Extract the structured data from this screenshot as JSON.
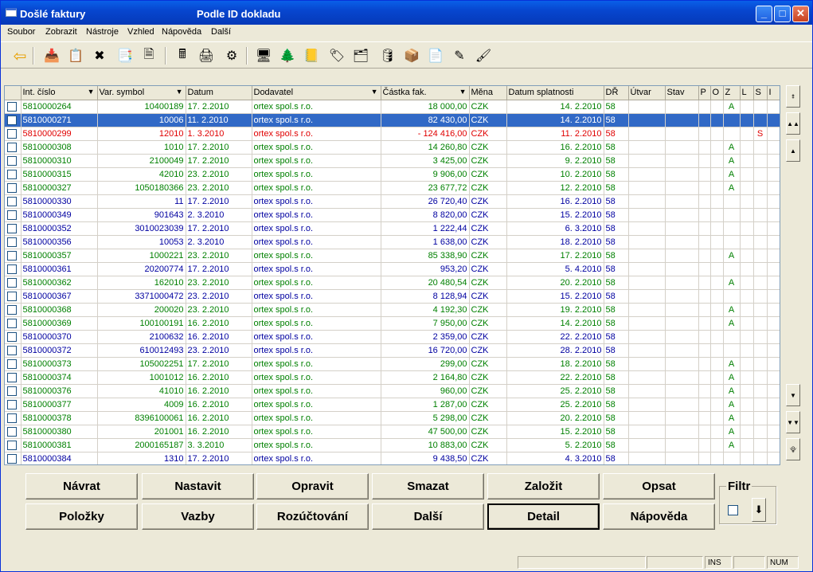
{
  "window": {
    "title": "Došlé faktury",
    "subtitle": "Podle ID dokladu",
    "min": "_",
    "max": "□",
    "close": "✕"
  },
  "menu": [
    "Soubor",
    "Zobrazit",
    "Nástroje",
    "Vzhled",
    "Nápověda",
    "Další"
  ],
  "toolbar": [
    "back-icon",
    "import-icon",
    "copy-icon",
    "delete-icon",
    "move-icon",
    "preview-icon",
    "calculator-icon",
    "print-icon",
    "settings-icon",
    "screen-icon",
    "tree-icon",
    "notebook-icon",
    "tag-icon",
    "stack-icon",
    "db-icon",
    "package-icon",
    "dph-icon",
    "edit-icon",
    "brush-icon"
  ],
  "columns": [
    {
      "label": "",
      "filter": false
    },
    {
      "label": "Int. číslo",
      "filter": true
    },
    {
      "label": "Var. symbol",
      "filter": true
    },
    {
      "label": "Datum",
      "filter": false
    },
    {
      "label": "Dodavatel",
      "filter": true
    },
    {
      "label": "Částka fak.",
      "filter": true
    },
    {
      "label": "Měna",
      "filter": false
    },
    {
      "label": "Datum splatnosti",
      "filter": false
    },
    {
      "label": "DŘ",
      "filter": false
    },
    {
      "label": "Útvar",
      "filter": false
    },
    {
      "label": "Stav",
      "filter": false
    },
    {
      "label": "P",
      "filter": false
    },
    {
      "label": "O",
      "filter": false
    },
    {
      "label": "Z",
      "filter": false
    },
    {
      "label": "L",
      "filter": false
    },
    {
      "label": "S",
      "filter": false
    },
    {
      "label": "I",
      "filter": false
    }
  ],
  "filter_arrow": "▼",
  "rows": [
    {
      "c": "green",
      "cells": [
        "5810000264",
        "10400189",
        "17. 2.2010",
        "ortex spol.s r.o.",
        "18 000,00",
        "CZK",
        "14. 2.2010",
        "58",
        "",
        "",
        "",
        "",
        "A",
        "",
        "",
        ""
      ]
    },
    {
      "c": "green",
      "sel": true,
      "cells": [
        "5810000271",
        "10006",
        "11. 2.2010",
        "ortex spol.s r.o.",
        "82 430,00",
        "CZK",
        "14. 2.2010",
        "58",
        "",
        "",
        "",
        "",
        "",
        "",
        "",
        ""
      ]
    },
    {
      "c": "red",
      "cells": [
        "5810000299",
        "12010",
        "1. 3.2010",
        "ortex spol.s r.o.",
        "- 124 416,00",
        "CZK",
        "11. 2.2010",
        "58",
        "",
        "",
        "",
        "",
        "",
        "",
        "S",
        ""
      ]
    },
    {
      "c": "green",
      "cells": [
        "5810000308",
        "1010",
        "17. 2.2010",
        "ortex spol.s r.o.",
        "14 260,80",
        "CZK",
        "16. 2.2010",
        "58",
        "",
        "",
        "",
        "",
        "A",
        "",
        "",
        ""
      ]
    },
    {
      "c": "green",
      "cells": [
        "5810000310",
        "2100049",
        "17. 2.2010",
        "ortex spol.s r.o.",
        "3 425,00",
        "CZK",
        "9. 2.2010",
        "58",
        "",
        "",
        "",
        "",
        "A",
        "",
        "",
        ""
      ]
    },
    {
      "c": "green",
      "cells": [
        "5810000315",
        "42010",
        "23. 2.2010",
        "ortex spol.s r.o.",
        "9 906,00",
        "CZK",
        "10. 2.2010",
        "58",
        "",
        "",
        "",
        "",
        "A",
        "",
        "",
        ""
      ]
    },
    {
      "c": "green",
      "cells": [
        "5810000327",
        "1050180366",
        "23. 2.2010",
        "ortex spol.s r.o.",
        "23 677,72",
        "CZK",
        "12. 2.2010",
        "58",
        "",
        "",
        "",
        "",
        "A",
        "",
        "",
        ""
      ]
    },
    {
      "c": "blue",
      "cells": [
        "5810000330",
        "11",
        "17. 2.2010",
        "ortex spol.s r.o.",
        "26 720,40",
        "CZK",
        "16. 2.2010",
        "58",
        "",
        "",
        "",
        "",
        "",
        "",
        "",
        ""
      ]
    },
    {
      "c": "blue",
      "cells": [
        "5810000349",
        "901643",
        "2. 3.2010",
        "ortex spol.s r.o.",
        "8 820,00",
        "CZK",
        "15. 2.2010",
        "58",
        "",
        "",
        "",
        "",
        "",
        "",
        "",
        ""
      ]
    },
    {
      "c": "blue",
      "cells": [
        "5810000352",
        "3010023039",
        "17. 2.2010",
        "ortex spol.s r.o.",
        "1 222,44",
        "CZK",
        "6. 3.2010",
        "58",
        "",
        "",
        "",
        "",
        "",
        "",
        "",
        ""
      ]
    },
    {
      "c": "blue",
      "cells": [
        "5810000356",
        "10053",
        "2. 3.2010",
        "ortex spol.s r.o.",
        "1 638,00",
        "CZK",
        "18. 2.2010",
        "58",
        "",
        "",
        "",
        "",
        "",
        "",
        "",
        ""
      ]
    },
    {
      "c": "green",
      "cells": [
        "5810000357",
        "1000221",
        "23. 2.2010",
        "ortex spol.s r.o.",
        "85 338,90",
        "CZK",
        "17. 2.2010",
        "58",
        "",
        "",
        "",
        "",
        "A",
        "",
        "",
        ""
      ]
    },
    {
      "c": "blue",
      "cells": [
        "5810000361",
        "20200774",
        "17. 2.2010",
        "ortex spol.s r.o.",
        "953,20",
        "CZK",
        "5. 4.2010",
        "58",
        "",
        "",
        "",
        "",
        "",
        "",
        "",
        ""
      ]
    },
    {
      "c": "green",
      "cells": [
        "5810000362",
        "162010",
        "23. 2.2010",
        "ortex spol.s r.o.",
        "20 480,54",
        "CZK",
        "20. 2.2010",
        "58",
        "",
        "",
        "",
        "",
        "A",
        "",
        "",
        ""
      ]
    },
    {
      "c": "blue",
      "cells": [
        "5810000367",
        "3371000472",
        "23. 2.2010",
        "ortex spol.s r.o.",
        "8 128,94",
        "CZK",
        "15. 2.2010",
        "58",
        "",
        "",
        "",
        "",
        "",
        "",
        "",
        ""
      ]
    },
    {
      "c": "green",
      "cells": [
        "5810000368",
        "200020",
        "23. 2.2010",
        "ortex spol.s r.o.",
        "4 192,30",
        "CZK",
        "19. 2.2010",
        "58",
        "",
        "",
        "",
        "",
        "A",
        "",
        "",
        ""
      ]
    },
    {
      "c": "green",
      "cells": [
        "5810000369",
        "100100191",
        "16. 2.2010",
        "ortex spol.s r.o.",
        "7 950,00",
        "CZK",
        "14. 2.2010",
        "58",
        "",
        "",
        "",
        "",
        "A",
        "",
        "",
        ""
      ]
    },
    {
      "c": "blue",
      "cells": [
        "5810000370",
        "2100632",
        "16. 2.2010",
        "ortex spol.s r.o.",
        "2 359,00",
        "CZK",
        "22. 2.2010",
        "58",
        "",
        "",
        "",
        "",
        "",
        "",
        "",
        ""
      ]
    },
    {
      "c": "blue",
      "cells": [
        "5810000372",
        "610012493",
        "23. 2.2010",
        "ortex spol.s r.o.",
        "16 720,00",
        "CZK",
        "28. 2.2010",
        "58",
        "",
        "",
        "",
        "",
        "",
        "",
        "",
        ""
      ]
    },
    {
      "c": "green",
      "cells": [
        "5810000373",
        "105002251",
        "17. 2.2010",
        "ortex spol.s r.o.",
        "299,00",
        "CZK",
        "18. 2.2010",
        "58",
        "",
        "",
        "",
        "",
        "A",
        "",
        "",
        ""
      ]
    },
    {
      "c": "green",
      "cells": [
        "5810000374",
        "1001012",
        "16. 2.2010",
        "ortex spol.s r.o.",
        "2 164,80",
        "CZK",
        "22. 2.2010",
        "58",
        "",
        "",
        "",
        "",
        "A",
        "",
        "",
        ""
      ]
    },
    {
      "c": "green",
      "cells": [
        "5810000376",
        "41010",
        "16. 2.2010",
        "ortex spol.s r.o.",
        "960,00",
        "CZK",
        "25. 2.2010",
        "58",
        "",
        "",
        "",
        "",
        "A",
        "",
        "",
        ""
      ]
    },
    {
      "c": "green",
      "cells": [
        "5810000377",
        "4009",
        "16. 2.2010",
        "ortex spol.s r.o.",
        "1 287,00",
        "CZK",
        "25. 2.2010",
        "58",
        "",
        "",
        "",
        "",
        "A",
        "",
        "",
        ""
      ]
    },
    {
      "c": "green",
      "cells": [
        "5810000378",
        "8396100061",
        "16. 2.2010",
        "ortex spol.s r.o.",
        "5 298,00",
        "CZK",
        "20. 2.2010",
        "58",
        "",
        "",
        "",
        "",
        "A",
        "",
        "",
        ""
      ]
    },
    {
      "c": "green",
      "cells": [
        "5810000380",
        "201001",
        "16. 2.2010",
        "ortex spol.s r.o.",
        "47 500,00",
        "CZK",
        "15. 2.2010",
        "58",
        "",
        "",
        "",
        "",
        "A",
        "",
        "",
        ""
      ]
    },
    {
      "c": "green",
      "cells": [
        "5810000381",
        "2000165187",
        "3. 3.2010",
        "ortex spol.s r.o.",
        "10 883,00",
        "CZK",
        "5. 2.2010",
        "58",
        "",
        "",
        "",
        "",
        "A",
        "",
        "",
        ""
      ]
    },
    {
      "c": "blue",
      "cells": [
        "5810000384",
        "1310",
        "17. 2.2010",
        "ortex spol.s r.o.",
        "9 438,50",
        "CZK",
        "4. 3.2010",
        "58",
        "",
        "",
        "",
        "",
        "",
        "",
        "",
        ""
      ]
    }
  ],
  "scrollbar": {
    "top": "⯒",
    "page_up": "▲▲",
    "up": "▲",
    "down": "▼",
    "page_down": "▼▼",
    "bottom": "⯓"
  },
  "buttons": {
    "row1": [
      {
        "label": "Návrat",
        "name": "navrat-button"
      },
      {
        "label": "Nastavit",
        "name": "nastavit-button"
      },
      {
        "label": "Opravit",
        "name": "opravit-button"
      },
      {
        "label": "Smazat",
        "name": "smazat-button"
      },
      {
        "label": "Založit",
        "name": "zalozit-button"
      },
      {
        "label": "Opsat",
        "name": "opsat-button"
      }
    ],
    "row2": [
      {
        "label": "Položky",
        "name": "polozky-button"
      },
      {
        "label": "Vazby",
        "name": "vazby-button"
      },
      {
        "label": "Rozúčtování",
        "name": "rozuctovani-button"
      },
      {
        "label": "Další",
        "name": "dalsi-button"
      },
      {
        "label": "Detail",
        "name": "detail-button",
        "default": true
      },
      {
        "label": "Nápověda",
        "name": "napoveda-button"
      }
    ]
  },
  "filtr": {
    "label": "Filtr",
    "button": "⬇"
  },
  "status": {
    "ins": "INS",
    "num": "NUM"
  }
}
